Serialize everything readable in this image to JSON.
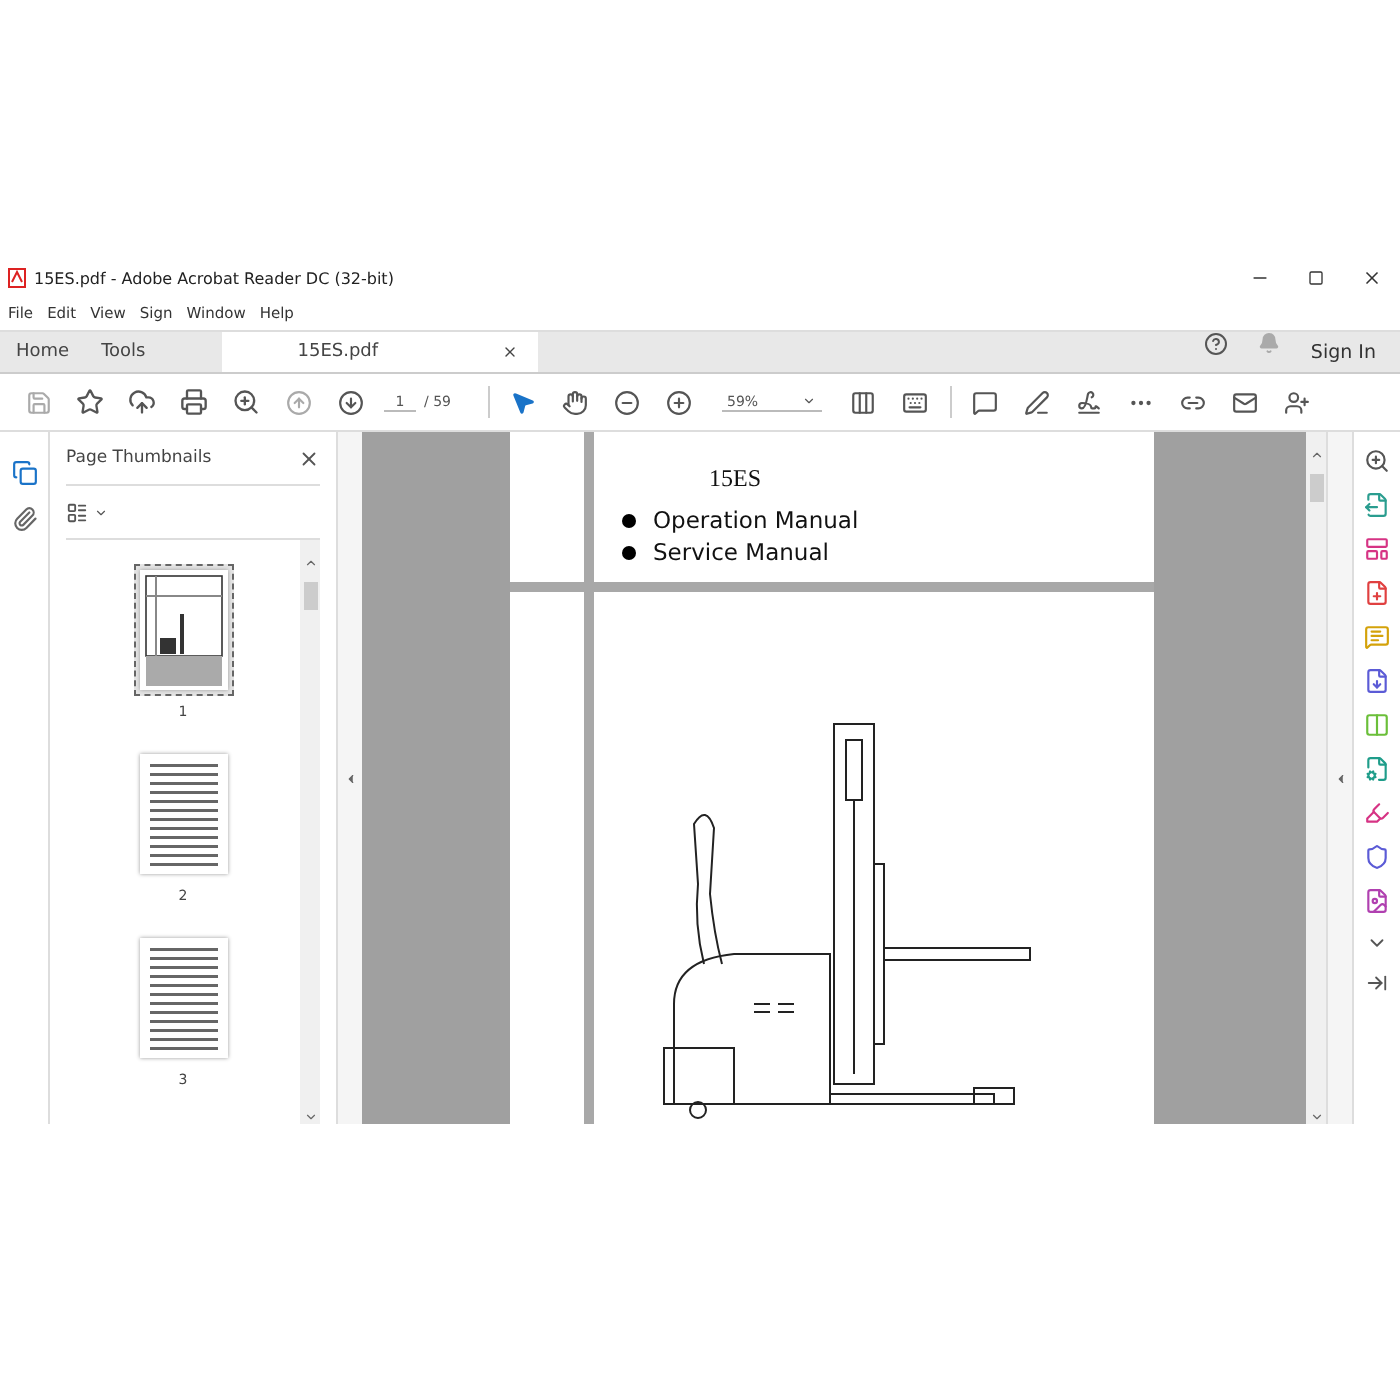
{
  "window": {
    "title": "15ES.pdf - Adobe Acrobat Reader DC (32-bit)"
  },
  "menu": [
    "File",
    "Edit",
    "View",
    "Sign",
    "Window",
    "Help"
  ],
  "tabs": [
    {
      "label": "Home",
      "selected": false,
      "kind": "nav"
    },
    {
      "label": "Tools",
      "selected": false,
      "kind": "nav"
    },
    {
      "label": "15ES.pdf",
      "selected": true,
      "kind": "doc"
    }
  ],
  "sign_in": "Sign In",
  "toolbar": {
    "page": "1",
    "page_total": "/ 59",
    "zoom": "59%"
  },
  "thumbnails_panel": {
    "title": "Page Thumbnails",
    "pages": [
      {
        "label": "1",
        "selected": true
      },
      {
        "label": "2",
        "selected": false
      },
      {
        "label": "3",
        "selected": false
      }
    ]
  },
  "document": {
    "model": "15ES",
    "items": [
      "Operation Manual",
      "Service Manual"
    ]
  }
}
